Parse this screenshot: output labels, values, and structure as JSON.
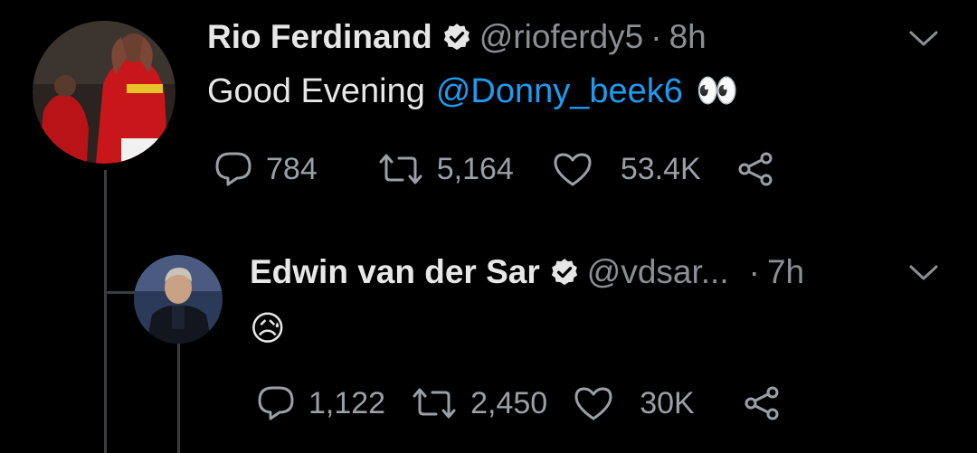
{
  "tweet1": {
    "name": "Rio Ferdinand",
    "handle": "@rioferdy5",
    "separator": "·",
    "time": "8h",
    "text": "Good Evening",
    "mention": "@Donny_beek6",
    "emoji": "👀",
    "replies": "784",
    "retweets": "5,164",
    "likes": "53.4K"
  },
  "tweet2": {
    "name": "Edwin van der Sar",
    "handle": "@vdsar...",
    "separator": "·",
    "time": "7h",
    "emoji": "😥",
    "replies": "1,122",
    "retweets": "2,450",
    "likes": "30K"
  },
  "colors": {
    "background": "#000000",
    "link": "#1d9bf0",
    "secondary_text": "#8b8f94",
    "thread_line": "#3a3d40"
  },
  "icons": [
    "verified-badge-icon",
    "chevron-down-icon",
    "reply-icon",
    "retweet-icon",
    "like-icon",
    "share-icon"
  ]
}
